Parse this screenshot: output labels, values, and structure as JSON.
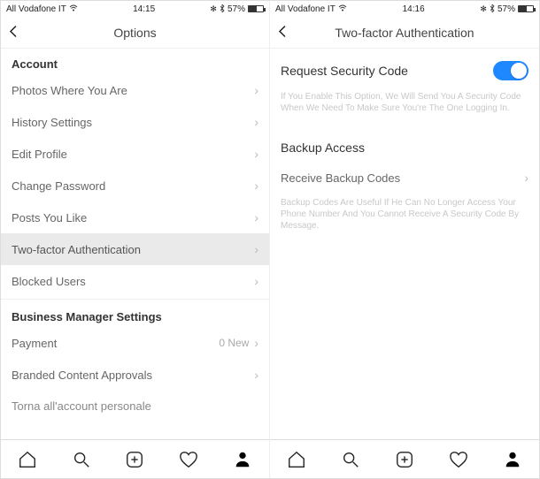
{
  "left": {
    "status": {
      "carrier": "All Vodafone IT",
      "time": "14:15",
      "battery": "57%"
    },
    "title": "Options",
    "sections": {
      "account": {
        "heading": "Account",
        "items": [
          {
            "label": "Photos Where You Are"
          },
          {
            "label": "History Settings"
          },
          {
            "label": "Edit Profile"
          },
          {
            "label": "Change Password"
          },
          {
            "label": "Posts You Like"
          },
          {
            "label": "Two-factor Authentication"
          },
          {
            "label": "Blocked Users"
          }
        ]
      },
      "business": {
        "heading": "Business Manager Settings",
        "items": [
          {
            "label": "Payment",
            "meta": "0 New"
          },
          {
            "label": "Branded Content Approvals"
          }
        ]
      },
      "trailing": "Torna all'account personale"
    }
  },
  "right": {
    "status": {
      "carrier": "All Vodafone IT",
      "time": "14:16",
      "battery": "57%"
    },
    "title": "Two-factor Authentication",
    "request": {
      "label": "Request Security Code",
      "help": "If You Enable This Option, We Will Send You A Security Code When We Need To Make Sure You're The One Logging In."
    },
    "backup": {
      "heading": "Backup Access",
      "item_label": "Receive Backup Codes",
      "help": "Backup Codes Are Useful If He Can No Longer Access Your Phone Number And You Cannot Receive A Security Code By Message."
    }
  }
}
